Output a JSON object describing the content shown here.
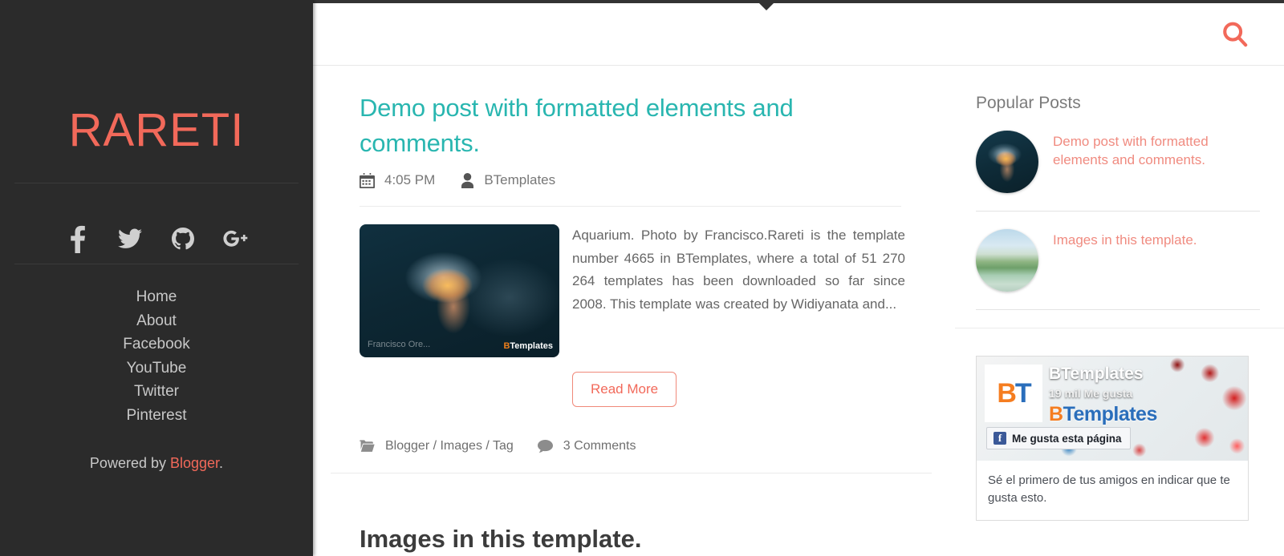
{
  "sidebar": {
    "brand": "RARETI",
    "social": [
      {
        "name": "facebook-icon",
        "label": "Facebook"
      },
      {
        "name": "twitter-icon",
        "label": "Twitter"
      },
      {
        "name": "github-icon",
        "label": "GitHub"
      },
      {
        "name": "googleplus-icon",
        "label": "Google Plus"
      }
    ],
    "menu": [
      {
        "label": "Home"
      },
      {
        "label": "About"
      },
      {
        "label": "Facebook"
      },
      {
        "label": "YouTube"
      },
      {
        "label": "Twitter"
      },
      {
        "label": "Pinterest"
      }
    ],
    "powered_prefix": "Powered by ",
    "powered_link": "Blogger",
    "powered_suffix": "."
  },
  "header": {
    "search_icon": "search-icon"
  },
  "post": {
    "title": "Demo post with formatted elements and comments.",
    "time": "4:05 PM",
    "author": "BTemplates",
    "thumb_watermark_left": "Francisco Ore...",
    "thumb_watermark_right_b": "B",
    "thumb_watermark_right_t": "Templates",
    "excerpt": "Aquarium. Photo by Francisco.Rareti is the template number 4665 in BTemplates, where a total of 51 270 264 templates has been downloaded so far since 2008. This template was created by Widiyanata and...",
    "read_more": "Read More",
    "categories": "Blogger / Images / Tag",
    "comments": "3 Comments"
  },
  "next_post": {
    "title": "Images in this template."
  },
  "aside": {
    "popular_posts_title": "Popular Posts",
    "popular_posts": [
      {
        "title": "Demo post with formatted elements and comments.",
        "thumb": "jelly"
      },
      {
        "title": "Images in this template.",
        "thumb": "river"
      }
    ],
    "facebook": {
      "page_name": "BTemplates",
      "likes": "19 mil Me gusta",
      "logo_b": "B",
      "logo_t": "Templates",
      "like_button": "Me gusta esta página",
      "body_text": "Sé el primero de tus amigos en indicar que te gusta esto."
    }
  },
  "colors": {
    "brand": "#f2695a",
    "title": "#29b6b0",
    "sidebar_bg": "#2b2b2b",
    "popular_link": "#f08b80"
  }
}
